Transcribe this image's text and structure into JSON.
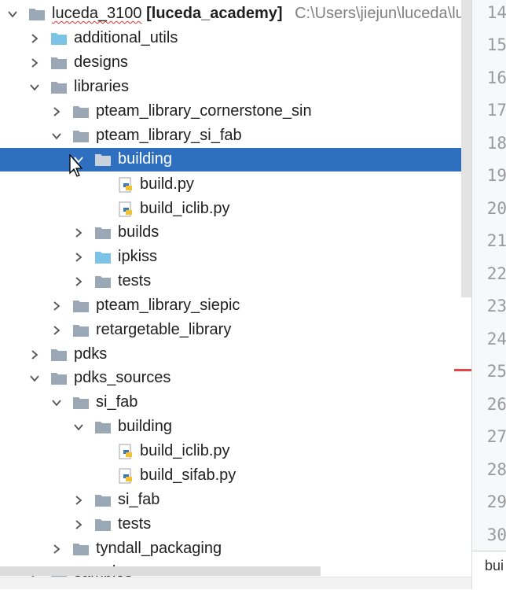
{
  "project_tree": {
    "root": {
      "name": "luceda_3100",
      "project": "[luceda_academy]",
      "path": "C:\\Users\\jiejun\\luceda\\luced"
    },
    "items": [
      {
        "label": "additional_utils",
        "icon": "folder-blue-icon"
      },
      {
        "label": "designs",
        "icon": "folder-icon"
      },
      {
        "label": "libraries",
        "icon": "folder-icon"
      },
      {
        "label": "pteam_library_cornerstone_sin",
        "icon": "folder-icon"
      },
      {
        "label": "pteam_library_si_fab",
        "icon": "folder-icon"
      },
      {
        "label": "building",
        "icon": "folder-icon",
        "selected": true
      },
      {
        "label": "build.py",
        "icon": "python-file-icon"
      },
      {
        "label": "build_iclib.py",
        "icon": "python-file-icon"
      },
      {
        "label": "builds",
        "icon": "folder-icon"
      },
      {
        "label": "ipkiss",
        "icon": "folder-blue-icon"
      },
      {
        "label": "tests",
        "icon": "folder-icon"
      },
      {
        "label": "pteam_library_siepic",
        "icon": "folder-icon"
      },
      {
        "label": "retargetable_library",
        "icon": "folder-icon"
      },
      {
        "label": "pdks",
        "icon": "folder-icon"
      },
      {
        "label": "pdks_sources",
        "icon": "folder-icon"
      },
      {
        "label": "si_fab",
        "icon": "folder-icon"
      },
      {
        "label": "building",
        "icon": "folder-icon"
      },
      {
        "label": "build_iclib.py",
        "icon": "python-file-icon"
      },
      {
        "label": "build_sifab.py",
        "icon": "python-file-icon"
      },
      {
        "label": "si_fab",
        "icon": "folder-icon"
      },
      {
        "label": "tests",
        "icon": "folder-icon"
      },
      {
        "label": "tyndall_packaging",
        "icon": "folder-icon"
      },
      {
        "label": "samples",
        "icon": "folder-icon"
      }
    ]
  },
  "editor": {
    "line_numbers": [
      "14",
      "15",
      "16",
      "17",
      "18",
      "19",
      "20",
      "21",
      "22",
      "23",
      "24",
      "25",
      "26",
      "27",
      "28",
      "29",
      "30"
    ],
    "tab_fragment": "bui"
  },
  "colors": {
    "selection": "#2f6fbf",
    "folder": "#9aa7b4",
    "folder_blue": "#7cc3e8",
    "error_marker": "#e04848"
  }
}
